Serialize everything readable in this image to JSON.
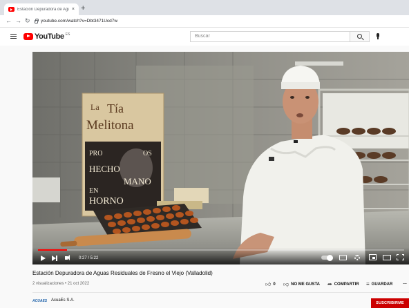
{
  "browser": {
    "tab_title": "Estación Depuradora de Aguas",
    "tab_close": "×",
    "new_tab": "+",
    "url": "youtube.com/watch?v=Dbt3471Ucd7w"
  },
  "masthead": {
    "logo_word": "YouTube",
    "logo_country": "ES",
    "search_placeholder": "Buscar"
  },
  "player": {
    "time": "0:27 / 5:22",
    "progress_fraction": 0.08,
    "scene_text": {
      "brand_la": "La",
      "brand_tia": "Tía",
      "brand_melitona": "Melitona",
      "line_pro": "PRO",
      "line_os": "OS",
      "line_hecho": "HECHO",
      "line_mano": "MANO",
      "line_en": "EN",
      "line_horno": "HORNO"
    }
  },
  "video": {
    "title": "Estación Depuradora de Aguas Residuales de Fresno el Viejo (Valladolid)",
    "meta": "2 visualizaciones • 21 oct 2022"
  },
  "actions": {
    "like_count": "0",
    "dislike_label": "NO ME GUSTA",
    "share_label": "COMPARTIR",
    "save_label": "GUARDAR",
    "more_label": "…"
  },
  "channel": {
    "avatar_text": "ACUAES",
    "name": "AcuaEs S.A.",
    "subscribers": "",
    "subscribe_label": "SUSCRIBIRME"
  },
  "colors": {
    "accent": "#ff0000",
    "subscribe": "#cc0000"
  }
}
